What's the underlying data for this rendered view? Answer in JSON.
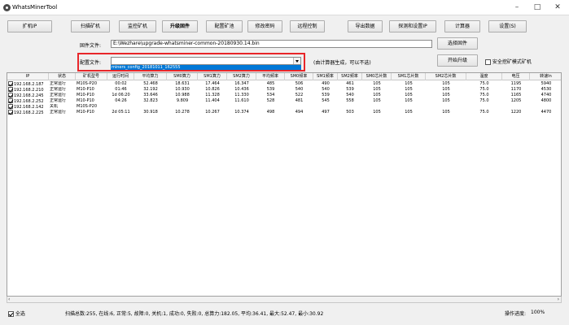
{
  "window": {
    "title": "WhatsMinerTool",
    "minimize": "–",
    "maximize": "□",
    "close": "✕"
  },
  "toolbar": {
    "scan_ip": "扩机IP",
    "scan_miner": "扫描矿机",
    "monitor": "监控矿机",
    "upgrade": "升级固件",
    "config_pool": "配置矿池",
    "change_password": "修改密码",
    "remote_control": "远程控制",
    "export": "导出数据",
    "detect_ip": "探测和设置IP",
    "calculator": "计算器",
    "settings": "设置(S)"
  },
  "firmware": {
    "label": "固件文件:",
    "path": "E:\\Wezhare\\upgrade-whatsminer-common-20180930.14.bin",
    "select_button": "选择固件"
  },
  "config": {
    "label": "配置文件:",
    "value": "",
    "dropdown_option": "miners_config_20181011_162555",
    "hint": "(由计算器生成，可以不选)",
    "start_button": "开始升级",
    "safe_mode_label": "安全挖矿模式矿机"
  },
  "table": {
    "headers": [
      "IP",
      "状态",
      "矿机型号",
      "运行时间",
      "平均算力",
      "SM0算力",
      "SM1算力",
      "SM2算力",
      "平均频率",
      "SM0频率",
      "SM1频率",
      "SM2频率",
      "SM0芯片数",
      "SM1芯片数",
      "SM2芯片数",
      "温度",
      "电压",
      "转速In"
    ],
    "rows": [
      [
        "192.168.2.187",
        "正常运行",
        "M10S-P20",
        "00:02",
        "52.468",
        "18.631",
        "17.464",
        "16.347",
        "485",
        "506",
        "490",
        "461",
        "105",
        "105",
        "105",
        "75.0",
        "1195",
        "5940"
      ],
      [
        "192.168.2.210",
        "正常运行",
        "M10-P10",
        "01:46",
        "32.192",
        "10.930",
        "10.826",
        "10.436",
        "539",
        "540",
        "540",
        "539",
        "105",
        "105",
        "105",
        "75.0",
        "1170",
        "4530"
      ],
      [
        "192.168.2.245",
        "正常运行",
        "M10-P10",
        "1d 06:20",
        "33.646",
        "10.988",
        "11.328",
        "11.330",
        "534",
        "522",
        "539",
        "540",
        "105",
        "105",
        "105",
        "75.0",
        "1165",
        "4740"
      ],
      [
        "192.168.2.252",
        "正常运行",
        "M10-P10",
        "04:26",
        "32.823",
        "9.809",
        "11.404",
        "11.610",
        "528",
        "481",
        "545",
        "558",
        "105",
        "105",
        "105",
        "75.0",
        "1205",
        "4800"
      ],
      [
        "192.168.2.142",
        "关机",
        "M10S-P20",
        "",
        "",
        "",
        "",
        "",
        "",
        "",
        "",
        "",
        "",
        "",
        "",
        "",
        "",
        ""
      ],
      [
        "192.168.2.225",
        "正常运行",
        "M10-P10",
        "2d 05:11",
        "30.918",
        "10.278",
        "10.267",
        "10.374",
        "498",
        "494",
        "497",
        "503",
        "105",
        "105",
        "105",
        "75.0",
        "1220",
        "4470"
      ]
    ]
  },
  "footer": {
    "select_all": "全选",
    "summary": "扫描总数:255, 在线:6, 正常:5, 故障:0, 关机:1, 成功:0, 失败:0, 总算力:182.05, 平均:36.41, 最大:52.47, 最小:30.92",
    "progress_label": "操作进度:",
    "progress_value": "100%"
  },
  "colors": {
    "highlight": "#e8262a",
    "selection": "#0078d7"
  }
}
